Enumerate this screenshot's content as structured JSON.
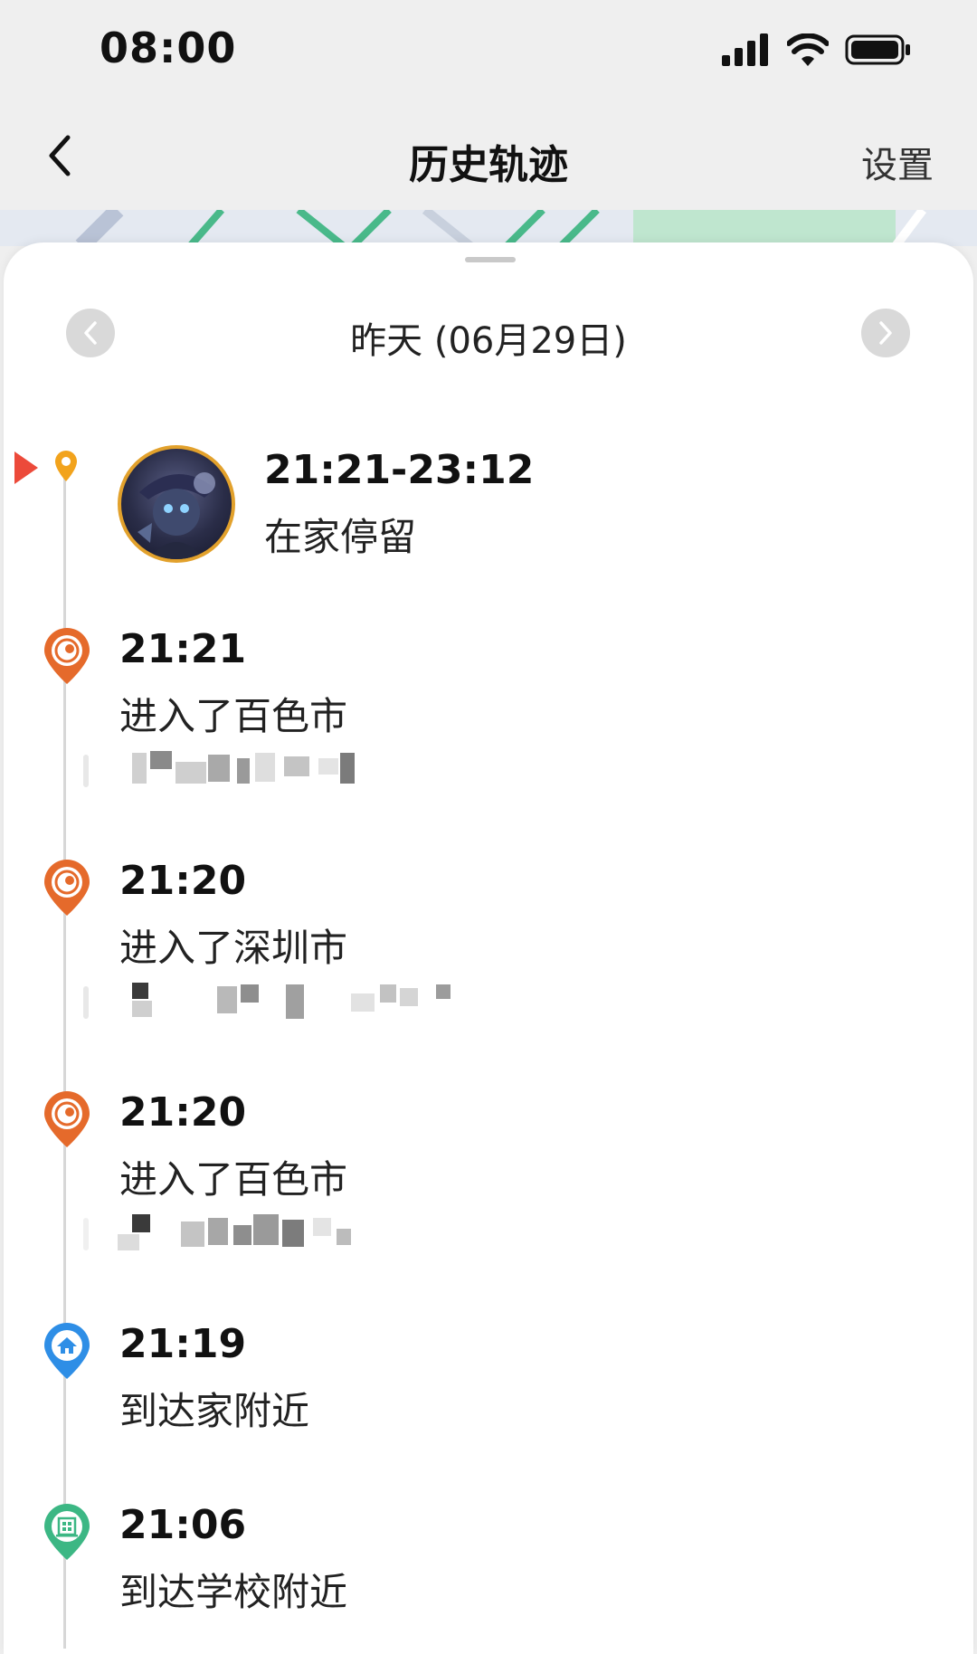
{
  "status_bar": {
    "time": "08:00"
  },
  "nav": {
    "title": "历史轨迹",
    "settings_label": "设置"
  },
  "date_selector": {
    "label": "昨天 (06月29日)"
  },
  "stay": {
    "time_range": "21:21-23:12",
    "description": "在家停留"
  },
  "entries": [
    {
      "time": "21:21",
      "description": "进入了百色市",
      "icon": "city-enter-icon",
      "color": "#e56a2b"
    },
    {
      "time": "21:20",
      "description": "进入了深圳市",
      "icon": "city-enter-icon",
      "color": "#e56a2b"
    },
    {
      "time": "21:20",
      "description": "进入了百色市",
      "icon": "city-enter-icon",
      "color": "#e56a2b"
    },
    {
      "time": "21:19",
      "description": "到达家附近",
      "icon": "home-icon",
      "color": "#2e8ee6"
    },
    {
      "time": "21:06",
      "description": "到达学校附近",
      "icon": "school-icon",
      "color": "#3cb784"
    }
  ],
  "colors": {
    "current_marker": "#ec4a3a",
    "stay_pin": "#f2a31c",
    "avatar_border": "#e2a12c"
  }
}
